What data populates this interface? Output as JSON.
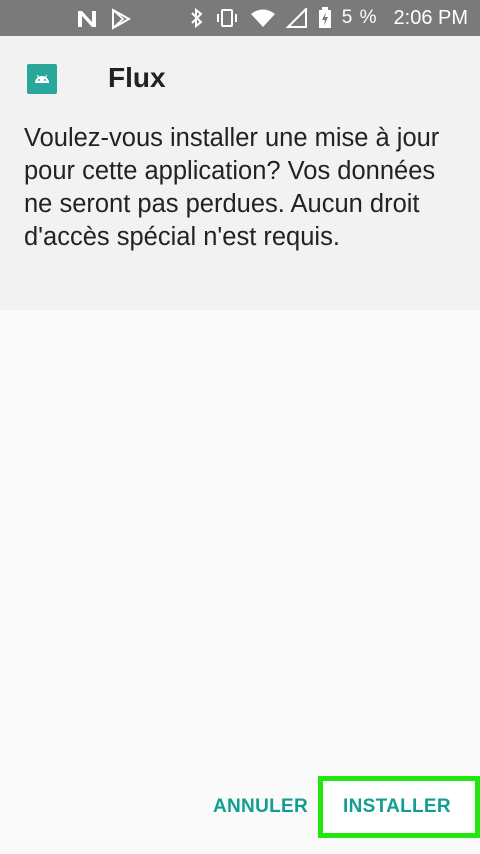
{
  "status_bar": {
    "battery_percent": "5 %",
    "time": "2:06 PM"
  },
  "dialog": {
    "app_name": "Flux",
    "message": "Voulez-vous installer une mise à jour pour cette application? Vos données ne seront pas perdues. Aucun droit d'accès spécial n'est requis."
  },
  "buttons": {
    "cancel_label": "ANNULER",
    "install_label": "INSTALLER"
  },
  "colors": {
    "accent": "#119e90",
    "highlight_border": "#22e60e",
    "status_bar": "#7a7a7a",
    "app_icon_bg": "#2aa79b"
  },
  "icons": {
    "status_left": [
      "n-notification-icon",
      "play-store-icon"
    ],
    "status_right": [
      "bluetooth-icon",
      "vibrate-icon",
      "wifi-icon",
      "no-signal-icon",
      "battery-charging-icon"
    ],
    "app": "android-icon"
  }
}
